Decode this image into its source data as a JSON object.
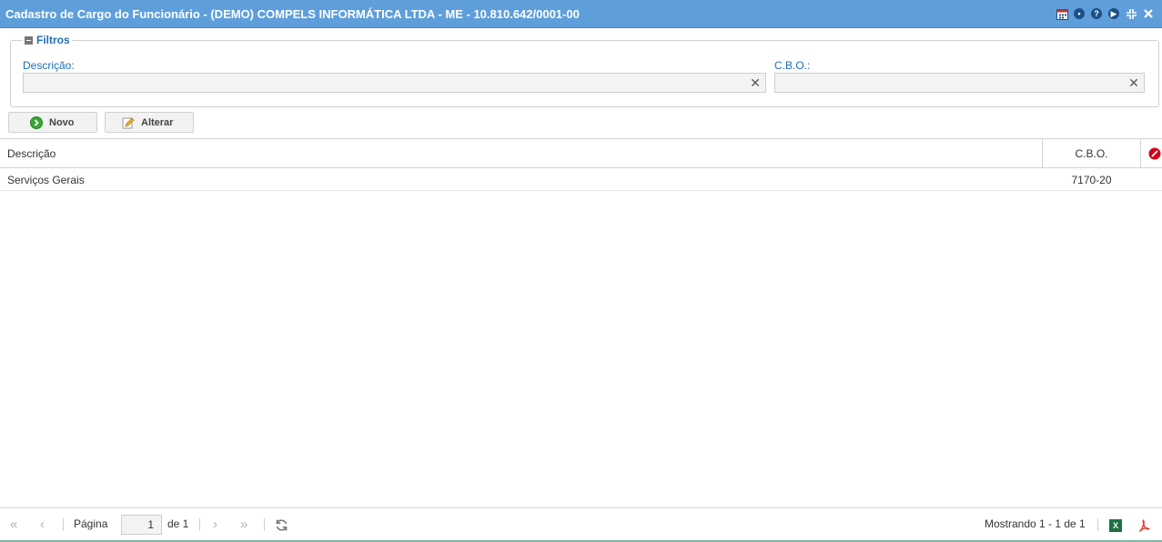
{
  "window": {
    "title": "Cadastro de Cargo do Funcionário - (DEMO) COMPELS INFORMÁTICA LTDA - ME - 10.810.642/0001-00",
    "tools": [
      "calendar-icon",
      "chat-icon",
      "help-icon",
      "play-icon",
      "collapse-icon",
      "close-icon"
    ]
  },
  "filters": {
    "legend": "Filtros",
    "descricao_label": "Descrição:",
    "descricao_value": "",
    "cbo_label": "C.B.O.:",
    "cbo_value": ""
  },
  "toolbar": {
    "novo_label": "Novo",
    "alterar_label": "Alterar"
  },
  "grid": {
    "columns": [
      "Descrição",
      "C.B.O."
    ],
    "rows": [
      {
        "descricao": "Serviços Gerais",
        "cbo": "7170-20"
      }
    ]
  },
  "pager": {
    "pagina_label": "Página",
    "page": "1",
    "of_label": "de 1",
    "showing": "Mostrando 1 - 1 de 1"
  },
  "colors": {
    "titlebar": "#5e9fdb",
    "label_blue": "#1f6fb5",
    "excel_green": "#1e7145",
    "pdf_red": "#e03c31"
  }
}
